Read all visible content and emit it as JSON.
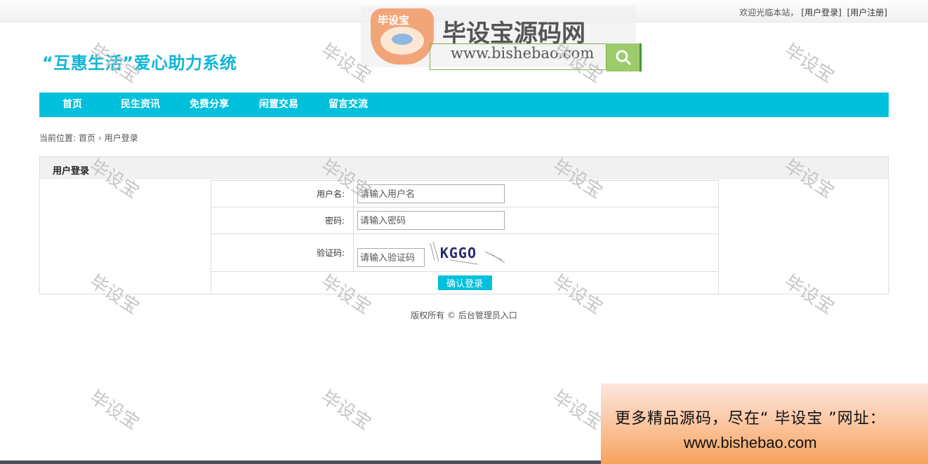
{
  "topbar": {
    "welcome": "欢迎光临本站，",
    "login_link": "[用户登录]",
    "register_link": "[用户注册]"
  },
  "site": {
    "title": "“互惠生活”爱心助力系统"
  },
  "watermark_banner": {
    "logo_text": "毕设宝",
    "title": "毕设宝源码网",
    "url": "www.bishebao.com"
  },
  "search": {
    "value": "",
    "icon": "search-icon"
  },
  "nav": {
    "items": [
      {
        "label": "首页"
      },
      {
        "label": "民生资讯"
      },
      {
        "label": "免费分享"
      },
      {
        "label": "闲置交易"
      },
      {
        "label": "留言交流"
      }
    ]
  },
  "breadcrumb": {
    "prefix": "当前位置:",
    "home": "首页",
    "separator": "›",
    "current": "用户登录"
  },
  "panel": {
    "title": "用户登录",
    "username_label": "用户名:",
    "username_placeholder": "请输入用户名",
    "password_label": "密码:",
    "password_placeholder": "请输入密码",
    "captcha_label": "验证码:",
    "captcha_placeholder": "请输入验证码",
    "captcha_text": "KGGO",
    "submit_label": "确认登录"
  },
  "footer": {
    "copyright": "版权所有 ©",
    "admin_link": "后台管理员入口"
  },
  "watermarks": {
    "text": "毕设宝"
  },
  "promo": {
    "line1": "更多精品源码，尽在“ 毕设宝 ”网址：",
    "line2": "www.bishebao.com"
  },
  "colors": {
    "accent": "#00c0dc",
    "title": "#12b5d6",
    "search_button": "#9ccb6b"
  }
}
